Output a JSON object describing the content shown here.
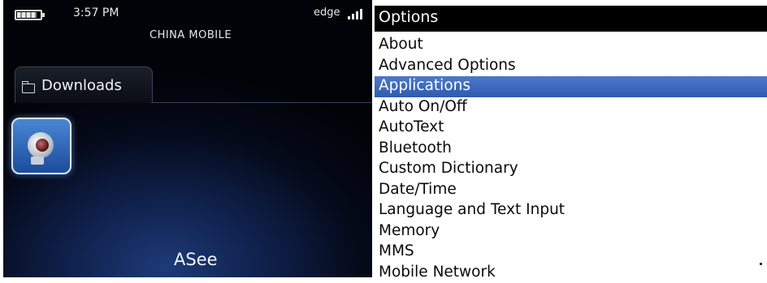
{
  "status_bar": {
    "time": "3:57 PM",
    "carrier": "CHINA MOBILE",
    "network": "edge",
    "icons": [
      "battery-icon",
      "signal-strength-icon"
    ]
  },
  "home": {
    "folder_label": "Downloads",
    "folder_icon": "folder-icon",
    "app_icon": "webcam-icon",
    "app_name": "ASee"
  },
  "options_menu": {
    "title": "Options",
    "selected_index": 2,
    "items": [
      "About",
      "Advanced Options",
      "Applications",
      "Auto On/Off",
      "AutoText",
      "Bluetooth",
      "Custom Dictionary",
      "Date/Time",
      "Language and Text Input",
      "Memory",
      "MMS",
      "Mobile Network"
    ]
  },
  "colors": {
    "selection": "#2f5bb0",
    "header_bg": "#000000"
  }
}
